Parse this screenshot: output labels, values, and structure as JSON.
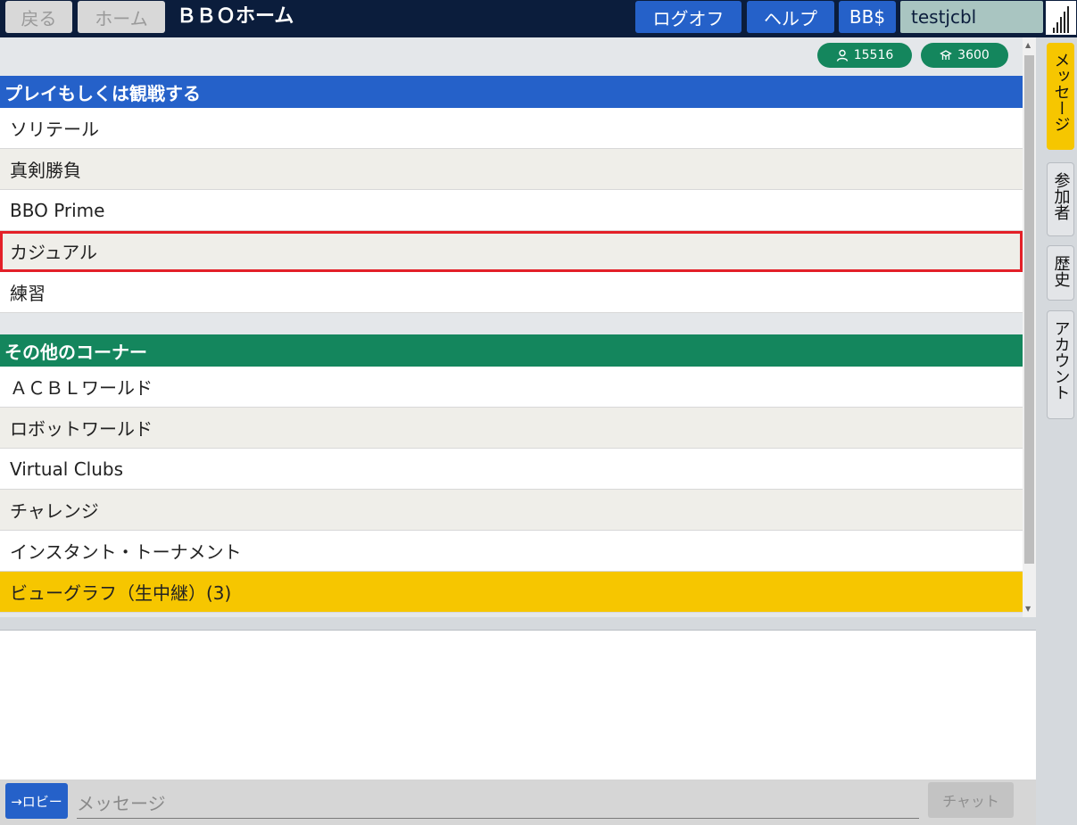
{
  "topbar": {
    "back_label": "戻る",
    "home_label": "ホーム",
    "app_title": "ＢＢＯホーム",
    "logoff_label": "ログオフ",
    "help_label": "ヘルプ",
    "bbdollar_label": "BB$",
    "username": "testjcbl"
  },
  "stats": {
    "users_count": "15516",
    "tables_count": "3600"
  },
  "play_section": {
    "header": "プレイもしくは観戦する",
    "items": [
      {
        "label": "ソリテール"
      },
      {
        "label": "真剣勝負"
      },
      {
        "label": "BBO Prime"
      },
      {
        "label": "カジュアル"
      },
      {
        "label": "練習"
      }
    ]
  },
  "other_section": {
    "header": "その他のコーナー",
    "items": [
      {
        "label": "ＡＣＢＬワールド"
      },
      {
        "label": "ロボットワールド"
      },
      {
        "label": "Virtual Clubs"
      },
      {
        "label": "チャレンジ"
      },
      {
        "label": "インスタント・トーナメント"
      },
      {
        "label": "ビューグラフ（生中継）(3)"
      }
    ]
  },
  "side_tabs": {
    "messages": "メッセージ",
    "participants": "参加者",
    "history": "歴史",
    "account": "アカウント"
  },
  "chat": {
    "lobby_label": "→ロビー",
    "input_placeholder": "メッセージ",
    "send_label": "チャット"
  },
  "colors": {
    "topbar_bg": "#0b1d3c",
    "primary_blue": "#2561c9",
    "section_green": "#14865d",
    "highlight_yellow": "#f6c600",
    "selection_red": "#e32028"
  }
}
